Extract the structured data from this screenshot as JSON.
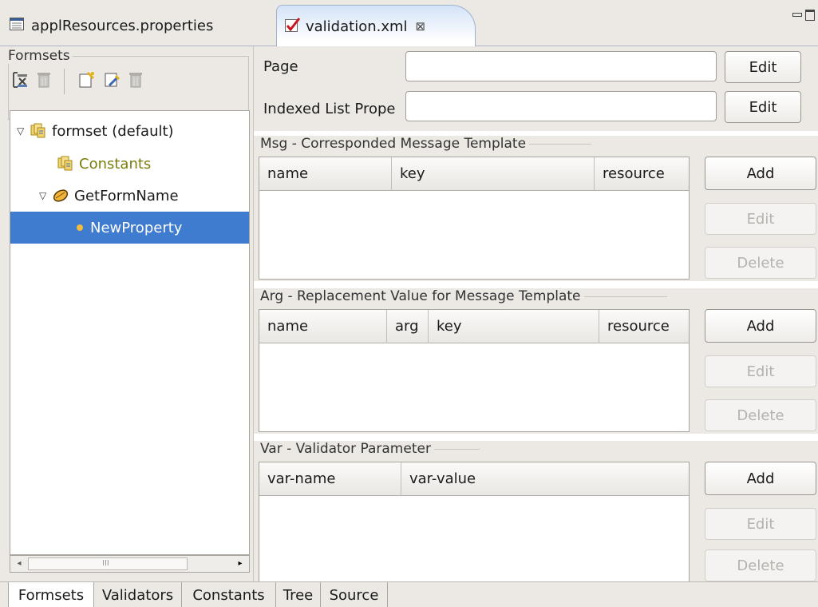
{
  "editor_tabs": [
    {
      "label": "applResources.properties",
      "icon": "properties-file-icon"
    },
    {
      "label": "validation.xml",
      "icon": "validation-check-icon",
      "close_glyph": "⊠"
    }
  ],
  "formsets_panel": {
    "legend": "Formsets",
    "tree": [
      {
        "label": "formset (default)",
        "icon": "formset-icon",
        "expanded": true
      },
      {
        "label": "Constants",
        "icon": "formset-icon"
      },
      {
        "label": "GetFormName",
        "icon": "form-icon",
        "expanded": true
      },
      {
        "label": "NewProperty",
        "icon": "field-dot-icon",
        "selected": true
      }
    ],
    "scroll_grip": "III"
  },
  "properties_panel": {
    "page_label": "Page",
    "page_value": "",
    "indexed_label": "Indexed List Prope",
    "indexed_value": "",
    "edit_label": "Edit"
  },
  "sections": {
    "msg": {
      "title": "Msg - Corresponded Message Template",
      "columns": [
        "name",
        "key",
        "resource"
      ]
    },
    "arg": {
      "title": "Arg - Replacement Value for Message Template",
      "columns": [
        "name",
        "arg",
        "key",
        "resource"
      ]
    },
    "var": {
      "title": "Var - Validator Parameter",
      "columns": [
        "var-name",
        "var-value"
      ]
    }
  },
  "buttons": {
    "add": "Add",
    "edit": "Edit",
    "delete": "Delete"
  },
  "bottom_tabs": [
    "Formsets",
    "Validators",
    "Constants",
    "Tree",
    "Source"
  ],
  "active_bottom_tab": "Formsets",
  "colors": {
    "selection": "#3f7ccf",
    "constants_text": "#7b7d0c",
    "panel_bg": "#ece9e5"
  }
}
